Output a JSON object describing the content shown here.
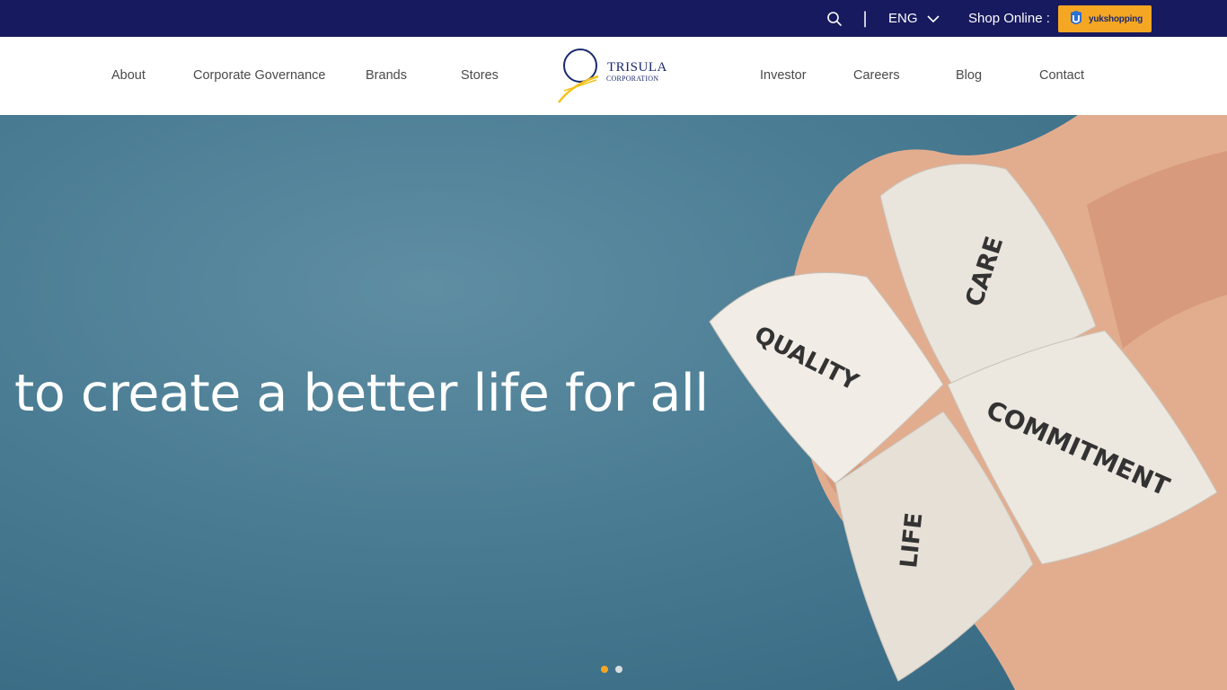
{
  "topbar": {
    "divider": "|",
    "language": "ENG",
    "shop_label": "Shop Online :",
    "shop_button": "yukshopping"
  },
  "nav": {
    "left": [
      "About",
      "Corporate Governance",
      "Brands",
      "Stores"
    ],
    "right": [
      "Investor",
      "Careers",
      "Blog",
      "Contact"
    ]
  },
  "brand": {
    "name": "TRISULA",
    "sub": "CORPORATION"
  },
  "hero": {
    "tagline": "to create a better life for all",
    "fortune_words": [
      "CARE",
      "QUALITY",
      "COMMITMENT",
      "LIFE"
    ],
    "slides_total": 2,
    "active_slide": 1
  },
  "colors": {
    "topbar_bg": "#171a5e",
    "shop_button_bg": "#f5a623",
    "dot_active": "#f5a623",
    "dot_inactive": "#d9dde0"
  },
  "icons": {
    "search": "search-icon",
    "language_dropdown": "chevron-down-icon"
  }
}
